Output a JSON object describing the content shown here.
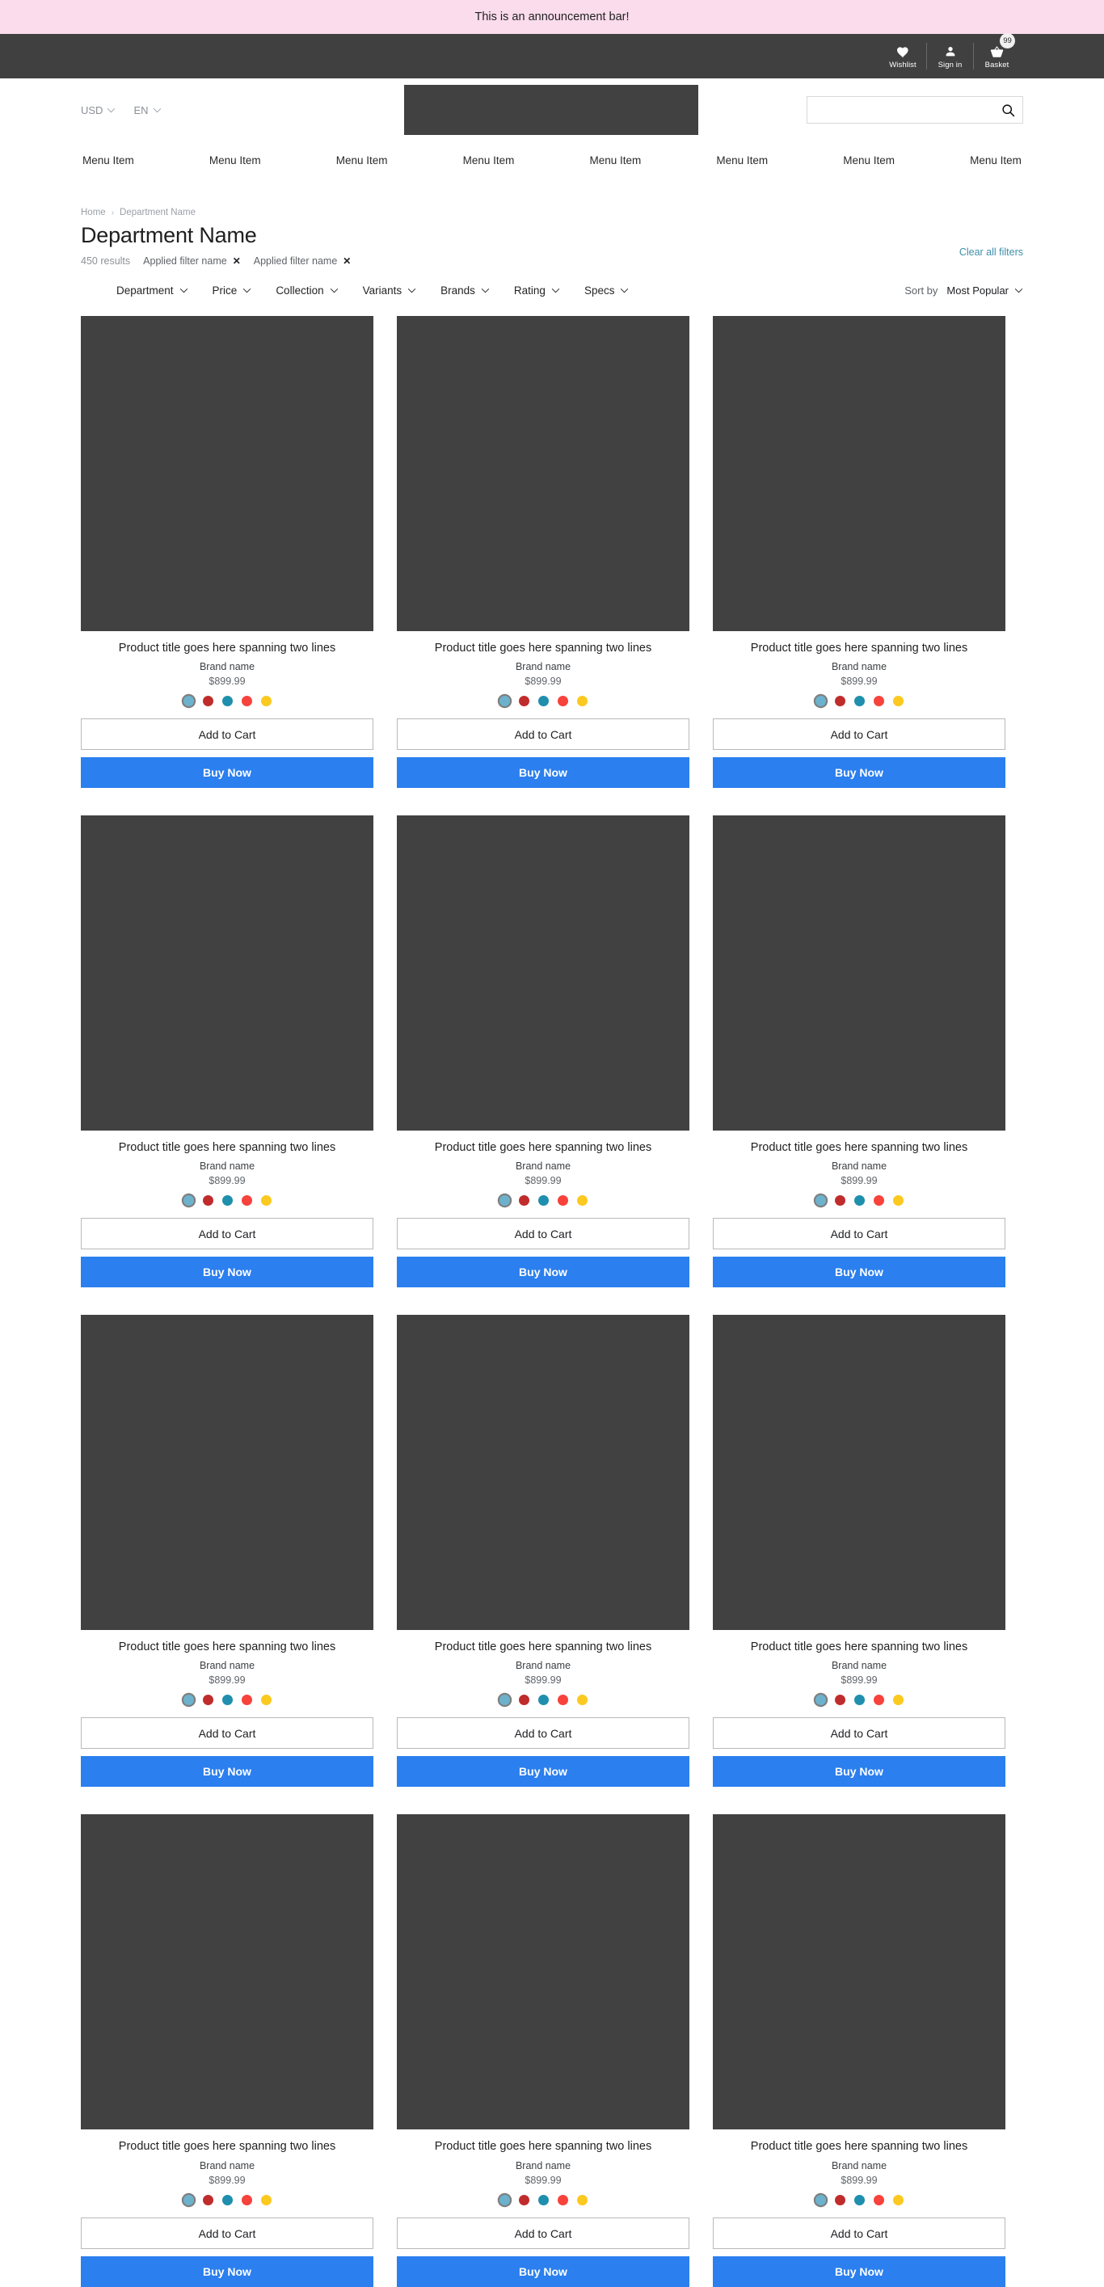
{
  "announcement": {
    "text": "This is an announcement bar!"
  },
  "utility": {
    "items": [
      {
        "label": "Wishlist",
        "icon": "heart-icon"
      },
      {
        "label": "Sign in",
        "icon": "person-icon"
      },
      {
        "label": "Basket",
        "icon": "basket-icon",
        "badge": "99"
      }
    ]
  },
  "header": {
    "currency": "USD",
    "language": "EN",
    "search": {
      "value": "",
      "placeholder": ""
    },
    "logo_alt": "logo-placeholder"
  },
  "nav": {
    "items": [
      {
        "label": "Menu Item"
      },
      {
        "label": "Menu Item"
      },
      {
        "label": "Menu Item"
      },
      {
        "label": "Menu Item"
      },
      {
        "label": "Menu Item"
      },
      {
        "label": "Menu Item"
      },
      {
        "label": "Menu Item"
      },
      {
        "label": "Menu Item"
      }
    ]
  },
  "page": {
    "breadcrumb": [
      {
        "label": "Home"
      },
      {
        "label": "Department Name"
      }
    ],
    "breadcrumb_separator": "›",
    "title": "Department Name",
    "results_count": "450 results",
    "applied_filters": [
      {
        "label": "Applied filter name",
        "remove": "✕"
      },
      {
        "label": "Applied filter name",
        "remove": "✕"
      }
    ],
    "clear_all": "Clear all filters"
  },
  "filter_bar": {
    "filters": [
      {
        "label": "Department"
      },
      {
        "label": "Price"
      },
      {
        "label": "Collection"
      },
      {
        "label": "Variants"
      },
      {
        "label": "Brands"
      },
      {
        "label": "Rating"
      },
      {
        "label": "Specs"
      }
    ],
    "sort": {
      "label": "Sort by",
      "value": "Most Popular"
    }
  },
  "colors": {
    "announcement_bg": "#fadcec",
    "utility_bg": "#404040",
    "placeholder": "#414141",
    "primary_button": "#2b7fee",
    "link": "#3d8faa",
    "swatch_light_blue": "#6cb2cd",
    "swatch_dark_red": "#c02c2c",
    "swatch_teal": "#1f8fad",
    "swatch_red": "#f8423c",
    "swatch_yellow": "#fbc91f"
  },
  "product_defaults": {
    "title": "Product title goes here spanning two lines",
    "brand": "Brand name",
    "price": "$899.99",
    "add_to_cart": "Add to Cart",
    "buy_now": "Buy Now",
    "swatches": [
      {
        "color": "#6cb2cd",
        "selected": true,
        "name": "light-blue"
      },
      {
        "color": "#c02c2c",
        "selected": false,
        "name": "dark-red"
      },
      {
        "color": "#1f8fad",
        "selected": false,
        "name": "teal"
      },
      {
        "color": "#f8423c",
        "selected": false,
        "name": "red"
      },
      {
        "color": "#fbc91f",
        "selected": false,
        "name": "yellow"
      }
    ]
  },
  "products": [
    {
      "title": "Product title goes here spanning two lines",
      "brand": "Brand name",
      "price": "$899.99",
      "add_to_cart": "Add to Cart",
      "buy_now": "Buy Now"
    },
    {
      "title": "Product title goes here spanning two lines",
      "brand": "Brand name",
      "price": "$899.99",
      "add_to_cart": "Add to Cart",
      "buy_now": "Buy Now"
    },
    {
      "title": "Product title goes here spanning two lines",
      "brand": "Brand name",
      "price": "$899.99",
      "add_to_cart": "Add to Cart",
      "buy_now": "Buy Now"
    },
    {
      "title": "Product title goes here spanning two lines",
      "brand": "Brand name",
      "price": "$899.99",
      "add_to_cart": "Add to Cart",
      "buy_now": "Buy Now"
    },
    {
      "title": "Product title goes here spanning two lines",
      "brand": "Brand name",
      "price": "$899.99",
      "add_to_cart": "Add to Cart",
      "buy_now": "Buy Now"
    },
    {
      "title": "Product title goes here spanning two lines",
      "brand": "Brand name",
      "price": "$899.99",
      "add_to_cart": "Add to Cart",
      "buy_now": "Buy Now"
    },
    {
      "title": "Product title goes here spanning two lines",
      "brand": "Brand name",
      "price": "$899.99",
      "add_to_cart": "Add to Cart",
      "buy_now": "Buy Now"
    },
    {
      "title": "Product title goes here spanning two lines",
      "brand": "Brand name",
      "price": "$899.99",
      "add_to_cart": "Add to Cart",
      "buy_now": "Buy Now"
    },
    {
      "title": "Product title goes here spanning two lines",
      "brand": "Brand name",
      "price": "$899.99",
      "add_to_cart": "Add to Cart",
      "buy_now": "Buy Now"
    },
    {
      "title": "Product title goes here spanning two lines",
      "brand": "Brand name",
      "price": "$899.99",
      "add_to_cart": "Add to Cart",
      "buy_now": "Buy Now"
    },
    {
      "title": "Product title goes here spanning two lines",
      "brand": "Brand name",
      "price": "$899.99",
      "add_to_cart": "Add to Cart",
      "buy_now": "Buy Now"
    },
    {
      "title": "Product title goes here spanning two lines",
      "brand": "Brand name",
      "price": "$899.99",
      "add_to_cart": "Add to Cart",
      "buy_now": "Buy Now"
    }
  ]
}
